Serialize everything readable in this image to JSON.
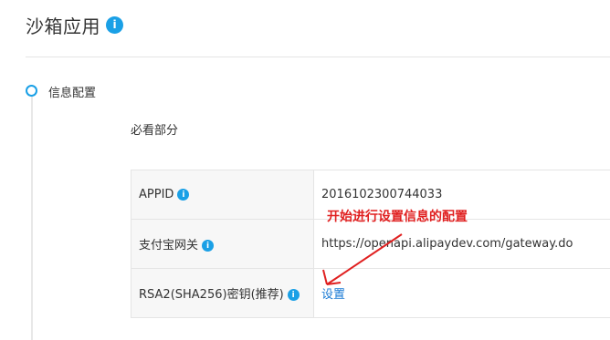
{
  "header": {
    "title": "沙箱应用",
    "info_icon": "i"
  },
  "section": {
    "title": "信息配置",
    "subtitle": "必看部分"
  },
  "rows": [
    {
      "label": "APPID",
      "info": "i",
      "value": "2016102300744033"
    },
    {
      "label": "支付宝网关",
      "info": "i",
      "value": "https://openapi.alipaydev.com/gateway.do"
    },
    {
      "label": "RSA2(SHA256)密钥(推荐)",
      "info": "i",
      "value": "设置"
    }
  ],
  "annotation": {
    "text": "开始进行设置信息的配置",
    "color": "#e02020"
  },
  "colors": {
    "accent": "#1aa0e6",
    "link": "#1a7ad4"
  }
}
